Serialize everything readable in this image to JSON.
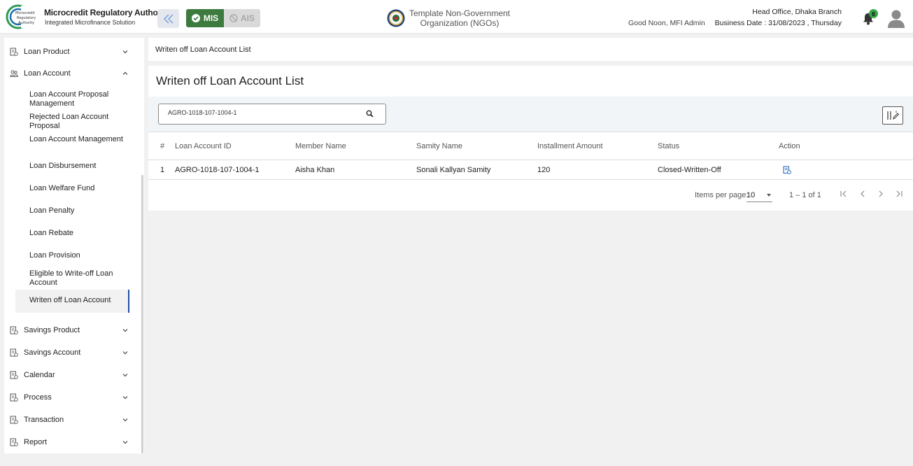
{
  "header": {
    "brand_title": "Microcredit Regulatory Authority",
    "brand_subtitle": "Integrated Microfinance Solution",
    "logo_text": "Microcredit Regulatory Authority",
    "mode_active": "MIS",
    "mode_inactive": "AIS",
    "org_line1": "Template Non-Government",
    "org_line2": "Organization (NGOs)",
    "greeting": "Good Noon, MFI Admin",
    "branch": "Head Office, Dhaka Branch",
    "business_date": "Business Date : 31/08/2023 , Thursday",
    "notification_count": "8"
  },
  "sidebar": {
    "loan_product": "Loan Product",
    "loan_account": "Loan Account",
    "sub_items": [
      "Loan Account Proposal Management",
      "Rejected Loan Account Proposal",
      "Loan Account Management",
      "Loan Disbursement",
      "Loan Welfare Fund",
      "Loan Penalty",
      "Loan Rebate",
      "Loan Provision",
      "Eligible to Write-off Loan Account",
      "Writen off Loan Account"
    ],
    "bottom_items": [
      "Savings Product",
      "Savings Account",
      "Calendar",
      "Process",
      "Transaction",
      "Report"
    ]
  },
  "breadcrumb": "Writen off Loan Account List",
  "page_title": "Writen off Loan Account List",
  "search": {
    "value": "AGRO-1018-107-1004-1"
  },
  "table": {
    "headers": [
      "#",
      "Loan Account ID",
      "Member Name",
      "Samity Name",
      "Installment Amount",
      "Status",
      "Action"
    ],
    "rows": [
      [
        "1",
        "AGRO-1018-107-1004-1",
        "Aisha Khan",
        "Sonali Kallyan Samity",
        "120",
        "Closed-Written-Off"
      ]
    ]
  },
  "paginator": {
    "label": "Items per page:",
    "page_size": "10",
    "range": "1 – 1 of 1"
  },
  "colors": {
    "accent": "#1f4fa3",
    "mis_green": "#3c7a3e",
    "badge_green": "#3aa64a"
  }
}
